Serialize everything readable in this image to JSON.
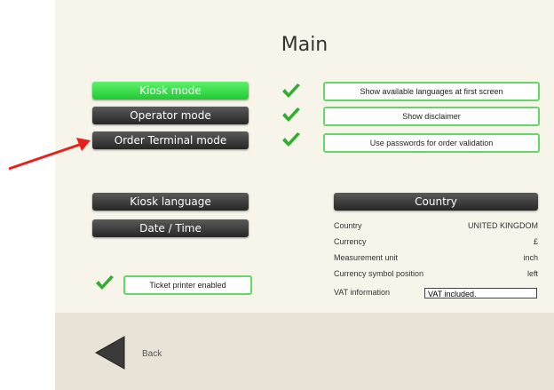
{
  "title": "Main",
  "modes": [
    {
      "label": "Kiosk mode",
      "active": true
    },
    {
      "label": "Operator mode",
      "active": false
    },
    {
      "label": "Order Terminal mode",
      "active": false
    }
  ],
  "options": [
    {
      "label": "Show available languages at first screen",
      "checked": true
    },
    {
      "label": "Show disclaimer",
      "checked": true
    },
    {
      "label": "Use passwords for order validation",
      "checked": true
    }
  ],
  "kiosk_language_label": "Kiosk language",
  "datetime_label": "Date / Time",
  "country_header": "Country",
  "country_info": {
    "country_label": "Country",
    "country_value": "UNITED KINGDOM",
    "currency_label": "Currency",
    "currency_value": "£",
    "unit_label": "Measurement unit",
    "unit_value": "inch",
    "symbol_pos_label": "Currency symbol position",
    "symbol_pos_value": "left",
    "vat_label": "VAT information",
    "vat_value": "VAT included."
  },
  "ticket_printer_label": "Ticket printer enabled",
  "back_label": "Back",
  "colors": {
    "accent_green": "#22c834",
    "check_green": "#2fae2f",
    "arrow_red": "#e8211b"
  }
}
